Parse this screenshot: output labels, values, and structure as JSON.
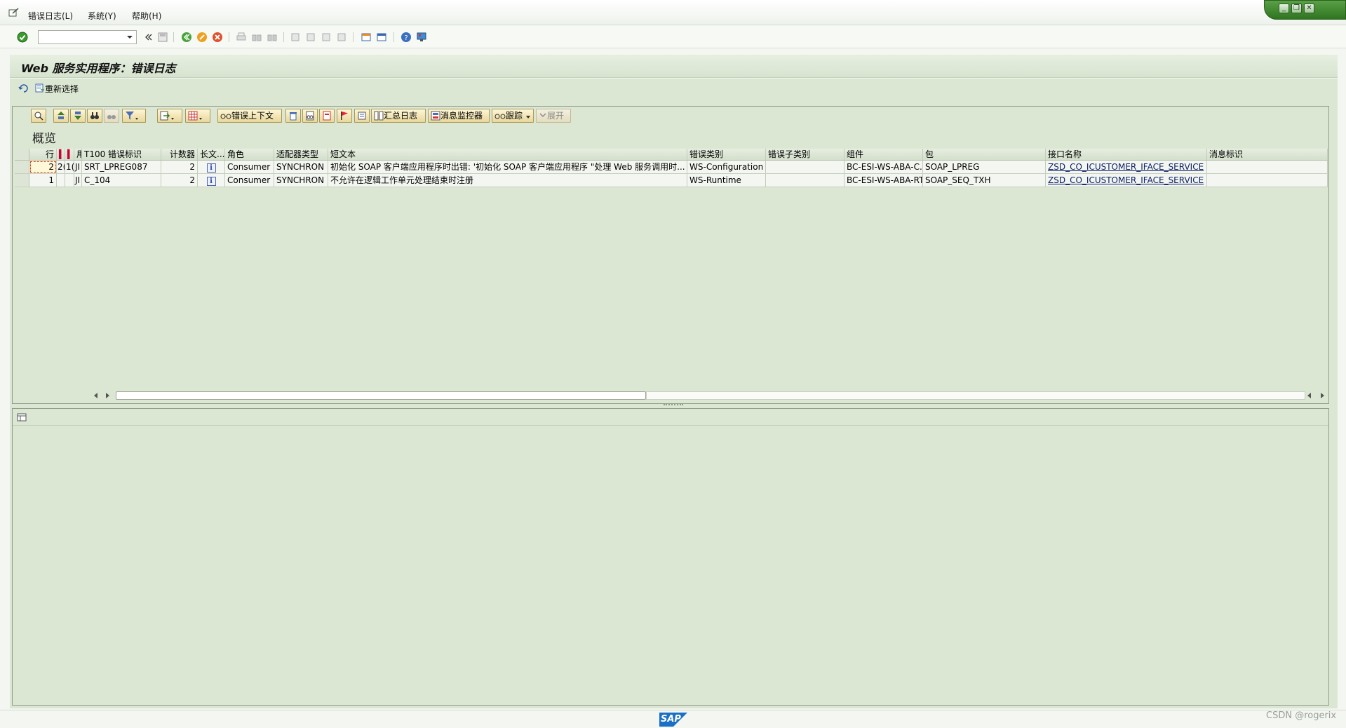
{
  "menu": {
    "items": [
      "错误日志(L)",
      "系统(Y)",
      "帮助(H)"
    ]
  },
  "window_controls": [
    "minimize",
    "restore",
    "close"
  ],
  "toolbar": {
    "command_field_value": ""
  },
  "title": "Web 服务实用程序：错误日志",
  "app_toolbar": {
    "reselect_label": "重新选择"
  },
  "alv_toolbar": {
    "error_context": "错误上下文",
    "summary_log": "汇总日志",
    "message_monitor": "消息监控器",
    "trace": "跟踪",
    "expand": "展开"
  },
  "overview_title": "概览",
  "grid": {
    "headers": {
      "row": "行",
      "c1": "",
      "c2": "",
      "c3": "用",
      "t100": "T100 错误标识",
      "counter": "计数器",
      "long_text": "长文...",
      "role": "角色",
      "adapter": "适配器类型",
      "short_text": "短文本",
      "err_cat": "错误类别",
      "err_sub": "错误子类别",
      "component": "组件",
      "package": "包",
      "iface": "接口名称",
      "msg_id": "消息标识"
    },
    "rows": [
      {
        "row": "2",
        "c1": "2(",
        "c2": "1(",
        "c3": "JI",
        "t100": "SRT_LPREG087",
        "counter": "2",
        "info": "i",
        "role": "Consumer",
        "adapter": "SYNCHRON",
        "short_text": "初始化 SOAP 客户端应用程序时出错: '初始化 SOAP 客户端应用程序 \"处理 Web 服务调用时...",
        "err_cat": "WS-Configuration",
        "err_sub": "",
        "component": "BC-ESI-WS-ABA-C...",
        "package": "SOAP_LPREG",
        "iface": "ZSD_CO_ICUSTOMER_IFACE_SERVICE",
        "msg_id": ""
      },
      {
        "row": "1",
        "c1": "",
        "c2": "",
        "c3": "JI",
        "t100": "C_104",
        "counter": "2",
        "info": "i",
        "role": "Consumer",
        "adapter": "SYNCHRON",
        "short_text": "不允许在逻辑工作单元处理结束时注册",
        "err_cat": "WS-Runtime",
        "err_sub": "",
        "component": "BC-ESI-WS-ABA-RT",
        "package": "SOAP_SEQ_TXH",
        "iface": "ZSD_CO_ICUSTOMER_IFACE_SERVICE",
        "msg_id": ""
      }
    ]
  },
  "status": {
    "logo": "SAP",
    "watermark": "CSDN @rogerix"
  },
  "colors": {
    "workarea": "#dce7d3",
    "title_bg": "#dde8d5",
    "button_bg": "#f3e7b5",
    "window_ctrl": "#3f8a2e"
  }
}
